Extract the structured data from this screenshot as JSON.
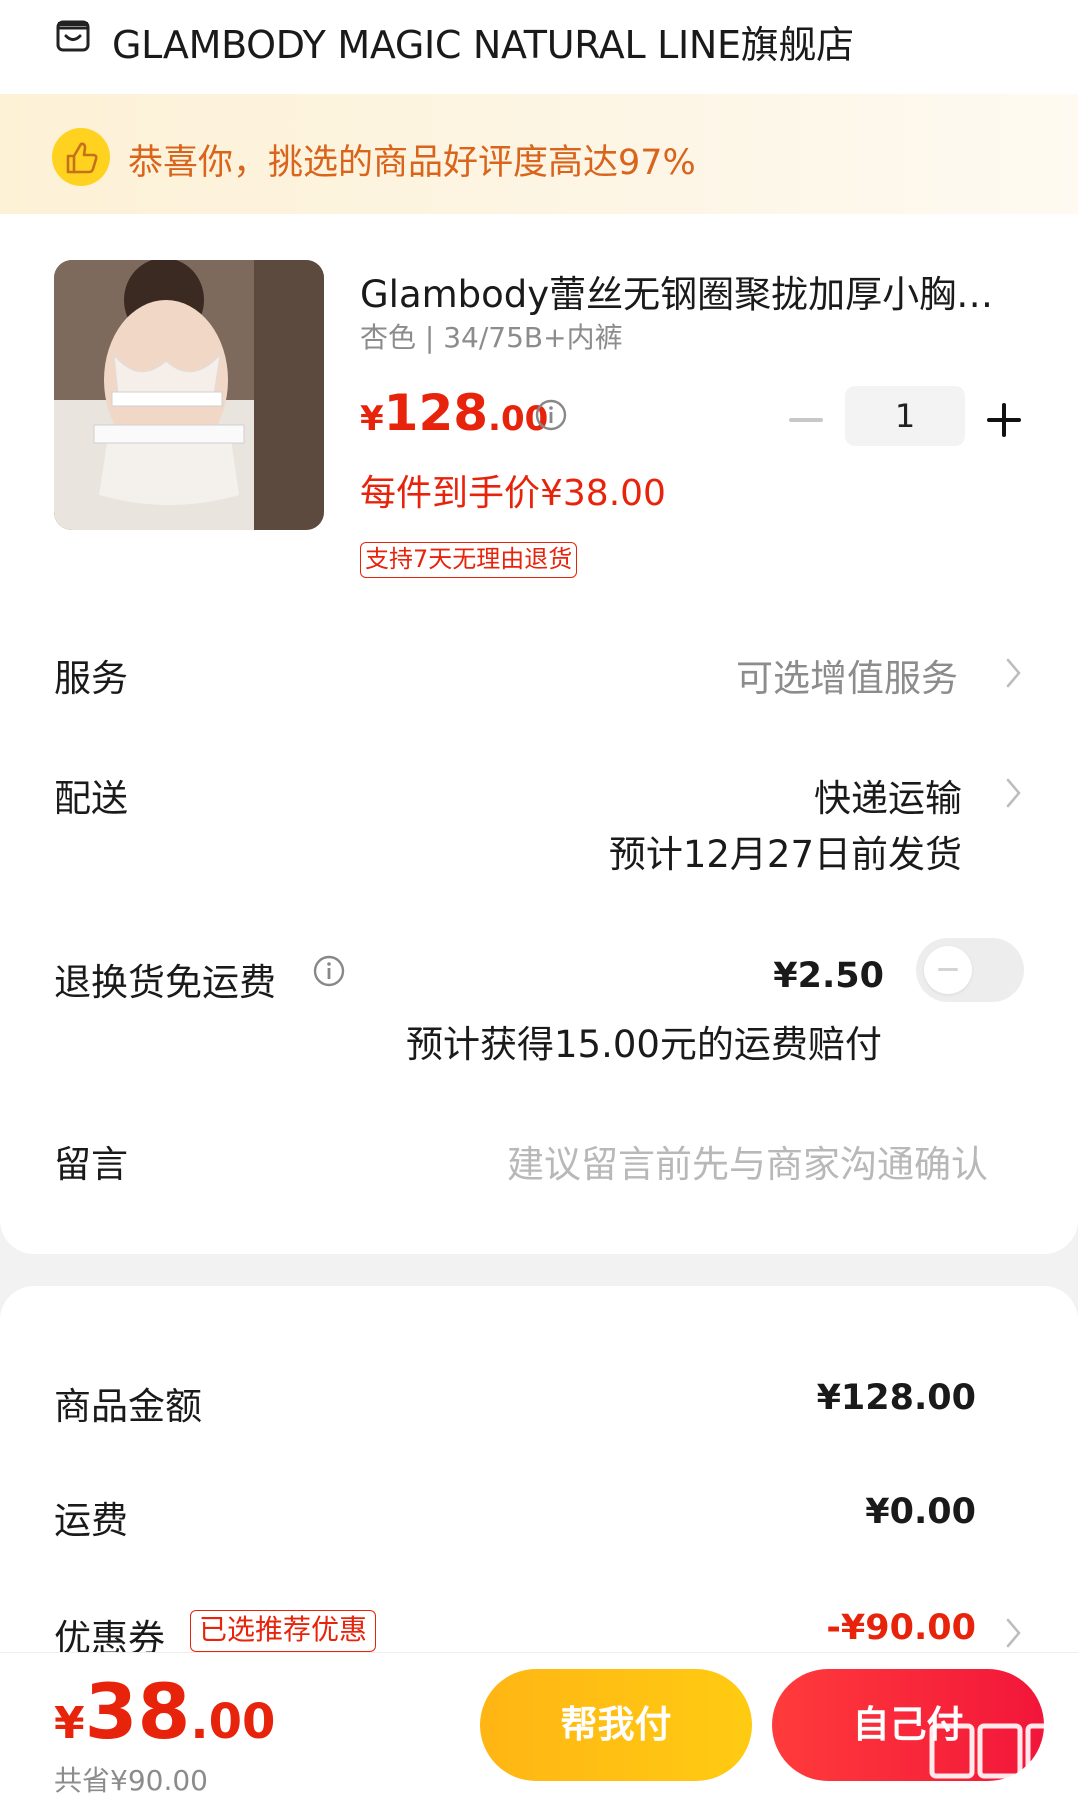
{
  "shop": {
    "name": "GLAMBODY MAGIC NATURAL LINE旗舰店",
    "icon": "shop-icon"
  },
  "banner": {
    "text": "恭喜你，挑选的商品好评度高达97%",
    "icon": "thumbs-up-icon",
    "color": "#d9641c"
  },
  "product": {
    "title": "Glambody蕾丝无钢圈聚拢加厚小胸…",
    "spec": "杏色 | 34/75B+内裤",
    "price_symbol": "¥",
    "price_int": "128",
    "price_dec": ".00",
    "quantity": "1",
    "final_price": "每件到手价¥38.00",
    "return_tag": "支持7天无理由退货"
  },
  "rows": {
    "service_label": "服务",
    "service_value": "可选增值服务",
    "delivery_label": "配送",
    "delivery_value": "快递运输",
    "delivery_eta": "预计12月27日前发货",
    "insurance_label": "退换货免运费",
    "insurance_price": "¥2.50",
    "insurance_note": "预计获得15.00元的运费赔付",
    "insurance_enabled": false,
    "message_label": "留言",
    "message_placeholder": "建议留言前先与商家沟通确认"
  },
  "summary": {
    "goods_label": "商品金额",
    "goods_value": "¥128.00",
    "shipping_label": "运费",
    "shipping_value": "¥0.00",
    "coupon_label": "优惠券",
    "coupon_tag": "已选推荐优惠",
    "coupon_value": "-¥90.00"
  },
  "footer": {
    "total_symbol": "¥",
    "total_int": "38",
    "total_dec": ".00",
    "saved": "共省¥90.00",
    "help_pay": "帮我付",
    "self_pay": "自己付"
  },
  "watermark": {
    "text": "值值值",
    "url": "zhizhizhi.com"
  },
  "colors": {
    "accent_red": "#e8230b",
    "help_pay_yellow": "#ffbe14",
    "self_pay_red": "#f5223c"
  }
}
